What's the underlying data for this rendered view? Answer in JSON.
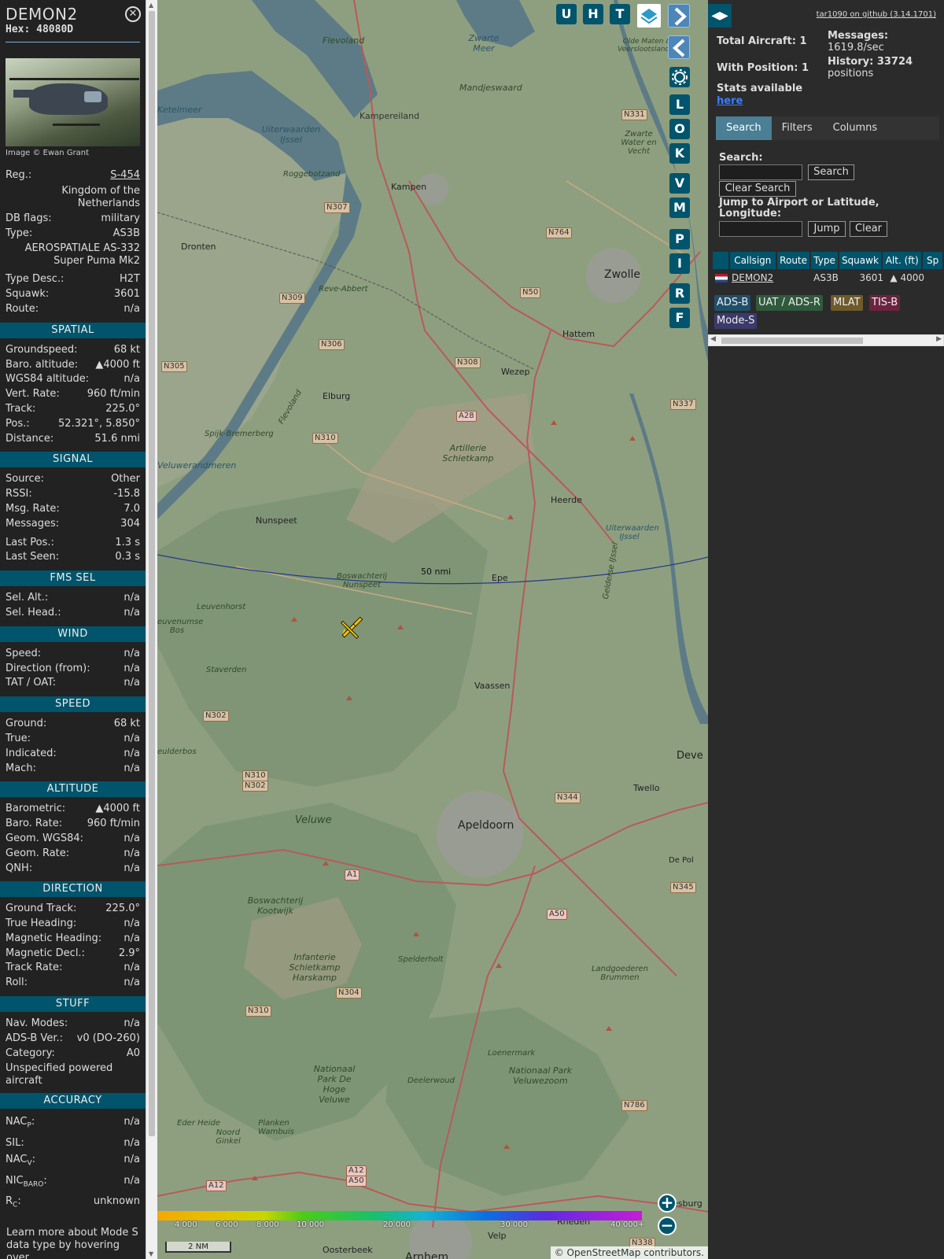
{
  "info": {
    "callsign": "DEMON2",
    "hex": "Hex: 48080D",
    "image_credit": "Image © Ewan Grant",
    "registration": {
      "label": "Reg.:",
      "value": "S-454"
    },
    "country": "Kingdom of the Netherlands",
    "db_flags": {
      "label": "DB flags:",
      "value": "military"
    },
    "type": {
      "label": "Type:",
      "value": "AS3B"
    },
    "type_full": "AEROSPATIALE AS-332 Super Puma Mk2",
    "type_desc": {
      "label": "Type Desc.:",
      "value": "H2T"
    },
    "squawk": {
      "label": "Squawk:",
      "value": "3601"
    },
    "route": {
      "label": "Route:",
      "value": "n/a"
    },
    "sections": {
      "spatial": "SPATIAL",
      "signal": "SIGNAL",
      "fms": "FMS SEL",
      "wind": "WIND",
      "speed": "SPEED",
      "altitude": "ALTITUDE",
      "direction": "DIRECTION",
      "stuff": "STUFF",
      "accuracy": "ACCURACY"
    },
    "spatial": [
      {
        "k": "Groundspeed:",
        "v": "68 kt"
      },
      {
        "k": "Baro. altitude:",
        "v": "▲4000 ft"
      },
      {
        "k": "WGS84 altitude:",
        "v": "n/a"
      },
      {
        "k": "Vert. Rate:",
        "v": "960 ft/min"
      },
      {
        "k": "Track:",
        "v": "225.0°"
      },
      {
        "k": "Pos.:",
        "v": "52.321°, 5.850°"
      },
      {
        "k": "Distance:",
        "v": "51.6 nmi"
      }
    ],
    "signal": [
      {
        "k": "Source:",
        "v": "Other"
      },
      {
        "k": "RSSI:",
        "v": "-15.8"
      },
      {
        "k": "Msg. Rate:",
        "v": "7.0"
      },
      {
        "k": "Messages:",
        "v": "304"
      }
    ],
    "signal2": [
      {
        "k": "Last Pos.:",
        "v": "1.3 s"
      },
      {
        "k": "Last Seen:",
        "v": "0.3 s"
      }
    ],
    "fms": [
      {
        "k": "Sel. Alt.:",
        "v": "n/a"
      },
      {
        "k": "Sel. Head.:",
        "v": "n/a"
      }
    ],
    "wind": [
      {
        "k": "Speed:",
        "v": "n/a"
      },
      {
        "k": "Direction (from):",
        "v": "n/a"
      },
      {
        "k": "TAT / OAT:",
        "v": "n/a"
      }
    ],
    "speed": [
      {
        "k": "Ground:",
        "v": "68 kt"
      },
      {
        "k": "True:",
        "v": "n/a"
      },
      {
        "k": "Indicated:",
        "v": "n/a"
      },
      {
        "k": "Mach:",
        "v": "n/a"
      }
    ],
    "altitude": [
      {
        "k": "Barometric:",
        "v": "▲4000 ft"
      },
      {
        "k": "Baro. Rate:",
        "v": "960 ft/min"
      },
      {
        "k": "Geom. WGS84:",
        "v": "n/a"
      },
      {
        "k": "Geom. Rate:",
        "v": "n/a"
      },
      {
        "k": "QNH:",
        "v": "n/a"
      }
    ],
    "direction": [
      {
        "k": "Ground Track:",
        "v": "225.0°"
      },
      {
        "k": "True Heading:",
        "v": "n/a"
      },
      {
        "k": "Magnetic Heading:",
        "v": "n/a"
      },
      {
        "k": "Magnetic Decl.:",
        "v": "2.9°"
      },
      {
        "k": "Track Rate:",
        "v": "n/a"
      },
      {
        "k": "Roll:",
        "v": "n/a"
      }
    ],
    "stuff": [
      {
        "k": "Nav. Modes:",
        "v": "n/a"
      },
      {
        "k": "ADS-B Ver.:",
        "v": "v0 (DO-260)"
      },
      {
        "k": "Category:",
        "v": "A0"
      }
    ],
    "category_desc": "Unspecified powered aircraft",
    "accuracy": [
      {
        "k": "NAC",
        "sub": "P",
        "v": "n/a"
      },
      {
        "k": "SIL:",
        "sub": "",
        "v": "n/a"
      },
      {
        "k": "NAC",
        "sub": "V",
        "v": "n/a"
      },
      {
        "k": "NIC",
        "sub": "BARO",
        "v": "n/a"
      },
      {
        "k": "R",
        "sub": "C",
        "v": "unknown"
      }
    ],
    "footer_note": "Learn more about Mode S data type by hovering over"
  },
  "map": {
    "buttons_top": [
      "U",
      "H",
      "T"
    ],
    "side_buttons": [
      "L",
      "O",
      "K",
      "V",
      "M",
      "P",
      "I",
      "R",
      "F"
    ],
    "range_ring_label": "50 nmi",
    "scale_label": "2 NM",
    "attribution": "© OpenStreetMap contributors.",
    "altitude_legend": [
      "4 000",
      "6 000",
      "8 000",
      "10 000",
      "20 000",
      "30 000",
      "40 000+"
    ],
    "places": {
      "dronten": "Dronten",
      "kampen": "Kampen",
      "kampereiland": "Kampereiland",
      "zwolle": "Zwolle",
      "hattem": "Hattem",
      "wezep": "Wezep",
      "elburg": "Elburg",
      "nunspeet": "Nunspeet",
      "heerde": "Heerde",
      "epe": "Epe",
      "vaassen": "Vaassen",
      "apeldoorn": "Apeldoorn",
      "twello": "Twello",
      "deve": "Deve",
      "oosterbeek": "Oosterbeek",
      "arnhem": "Arnhem",
      "velp": "Velp",
      "rheden": "Rheden",
      "mandjeswaard": "Mandjeswaard",
      "zwarte_meer": "Zwarte Meer",
      "ketelmeer": "Ketelmeer",
      "flevoland": "Flevoland",
      "flevoland2": "Flevoland",
      "uiterwaarden": "Uiterwaarden IJssel",
      "roggebotzand": "Roggebotzand",
      "reve_abbert": "Reve-Abbert",
      "spijk": "Spijk-Bremerberg",
      "veluwerandmeren": "Veluwerandmeren",
      "artillerie": "Artillerie Schietkamp",
      "boswachterij_nunspeet": "Boswachterij Nunspeet",
      "leuvenhorst": "Leuvenhorst",
      "veluwe": "Veluwe",
      "staverden": "Staverden",
      "boswachterij_kootwijk": "Boswachterij Kootwijk",
      "infanterie": "Infanterie Schietkamp Harskamp",
      "spelderholt": "Spelderholt",
      "nationaal_hoge_veluwe": "Nationaal Park De Hoge Veluwe",
      "deelerwoud": "Deelerwoud",
      "loenermark": "Loenermark",
      "landgoederen": "Landgoederen Brummen",
      "nationaal_veluwezoom": "Nationaal Park Veluwezoom",
      "eder_heide": "Eder Heide",
      "planken": "Planken Wambuis",
      "noord_ginkel": "Noord Ginkel",
      "de_pol": "De Pol",
      "uiterwaarden2": "Uiterwaarden IJssel",
      "olde_maten": "Olde Maten & Veerslootslanden",
      "zwarte_water": "Zwarte Water en Vecht",
      "euvenumse": "euvenumse Bos",
      "eulderbos": "eulderbos",
      "gelderse": "Gelderse IJssel",
      "esburg": "esburg"
    },
    "roads": [
      "N307",
      "N764",
      "N331",
      "N309",
      "N50",
      "N306",
      "N308",
      "N305",
      "N337",
      "A28",
      "N310",
      "N302",
      "N310",
      "N302",
      "N344",
      "A1",
      "A50",
      "N345",
      "N304",
      "N310",
      "N786",
      "A12",
      "A12",
      "A50",
      "N338"
    ],
    "aircraft_color": "#f2c200"
  },
  "sidebar": {
    "github": "tar1090 on github (3.14.1701)",
    "total_aircraft": "Total Aircraft: 1",
    "with_position": "With Position: 1",
    "stats_available": "Stats available",
    "stats_link": "here",
    "messages_label": "Messages:",
    "messages_value": "1619.8/sec",
    "history_label": "History: 33724",
    "history_value": "positions",
    "tabs": [
      "Search",
      "Filters",
      "Columns"
    ],
    "search_label": "Search:",
    "search_button": "Search",
    "clear_search_button": "Clear Search",
    "jump_label": "Jump to Airport or Latitude, Longitude:",
    "jump_button": "Jump",
    "clear_button": "Clear",
    "columns": [
      "Callsign",
      "Route",
      "Type",
      "Squawk",
      "Alt. (ft)",
      "Sp"
    ],
    "rows": [
      {
        "callsign": "DEMON2",
        "route": "",
        "type": "AS3B",
        "squawk": "3601",
        "alt": "▲ 4000"
      }
    ],
    "sources": [
      {
        "label": "ADS-B",
        "color": "#1f4f6b"
      },
      {
        "label": "UAT / ADS-R",
        "color": "#2f5a3c"
      },
      {
        "label": "MLAT",
        "color": "#6e5a2b"
      },
      {
        "label": "TIS-B",
        "color": "#6b2340"
      },
      {
        "label": "Mode-S",
        "color": "#3b3a6b"
      }
    ]
  }
}
